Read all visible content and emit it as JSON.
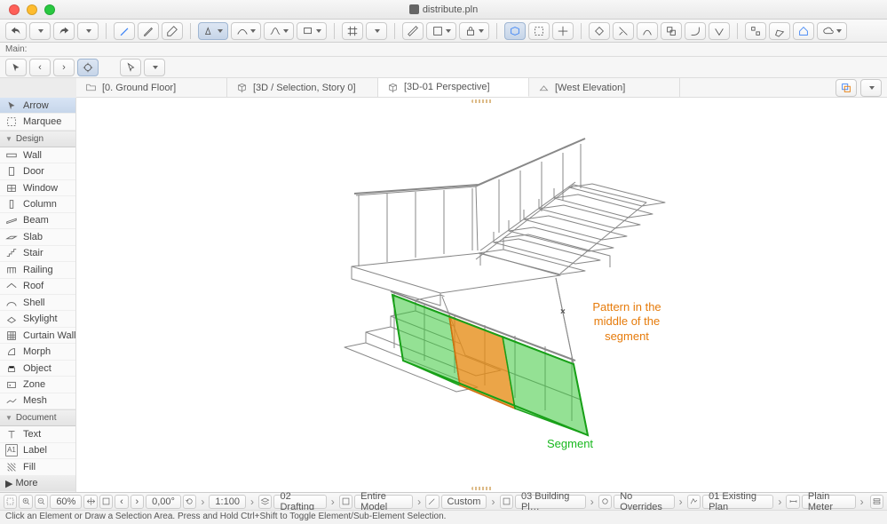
{
  "window": {
    "title": "distribute.pln"
  },
  "subtoolbar_label": "Main:",
  "view_tabs": [
    {
      "label": "[0. Ground Floor]"
    },
    {
      "label": "[3D / Selection, Story 0]"
    },
    {
      "label": "[3D-01 Perspective]"
    },
    {
      "label": "[West Elevation]"
    }
  ],
  "toolbox": {
    "cat_design": "Design",
    "cat_document": "Document",
    "more": "More",
    "items": [
      "Arrow",
      "Marquee",
      "Wall",
      "Door",
      "Window",
      "Column",
      "Beam",
      "Slab",
      "Stair",
      "Railing",
      "Roof",
      "Shell",
      "Skylight",
      "Curtain Wall",
      "Morph",
      "Object",
      "Zone",
      "Mesh",
      "Text",
      "Label",
      "Fill"
    ]
  },
  "annotations": {
    "orange": "Pattern in the\nmiddle of the\nsegment",
    "green": "Segment"
  },
  "status": {
    "zoom": "60%",
    "angle": "0,00°",
    "scale": "1:100",
    "layer_combo": "02 Drafting",
    "model_filter": "Entire Model",
    "pen_set": "Custom",
    "view_map": "03 Building Pl…",
    "overrides": "No Overrides",
    "reno": "01 Existing Plan",
    "dim": "Plain Meter"
  },
  "hint": "Click an Element or Draw a Selection Area. Press and Hold Ctrl+Shift to Toggle Element/Sub-Element Selection."
}
